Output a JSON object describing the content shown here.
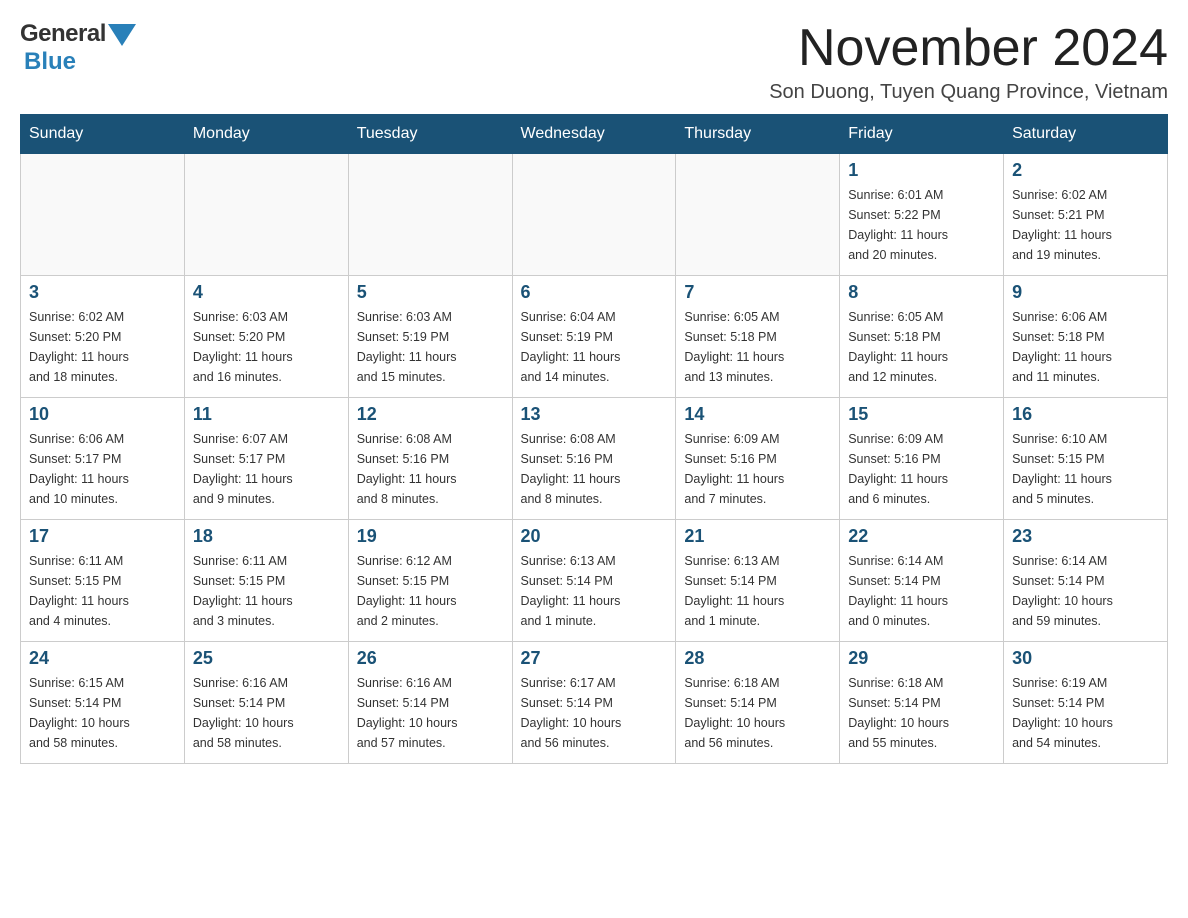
{
  "header": {
    "logo": {
      "general": "General",
      "blue": "Blue",
      "arrow_color": "#2980b9"
    },
    "title": "November 2024",
    "location": "Son Duong, Tuyen Quang Province, Vietnam"
  },
  "calendar": {
    "days_of_week": [
      "Sunday",
      "Monday",
      "Tuesday",
      "Wednesday",
      "Thursday",
      "Friday",
      "Saturday"
    ],
    "weeks": [
      {
        "days": [
          {
            "date": "",
            "info": ""
          },
          {
            "date": "",
            "info": ""
          },
          {
            "date": "",
            "info": ""
          },
          {
            "date": "",
            "info": ""
          },
          {
            "date": "",
            "info": ""
          },
          {
            "date": "1",
            "info": "Sunrise: 6:01 AM\nSunset: 5:22 PM\nDaylight: 11 hours\nand 20 minutes."
          },
          {
            "date": "2",
            "info": "Sunrise: 6:02 AM\nSunset: 5:21 PM\nDaylight: 11 hours\nand 19 minutes."
          }
        ]
      },
      {
        "days": [
          {
            "date": "3",
            "info": "Sunrise: 6:02 AM\nSunset: 5:20 PM\nDaylight: 11 hours\nand 18 minutes."
          },
          {
            "date": "4",
            "info": "Sunrise: 6:03 AM\nSunset: 5:20 PM\nDaylight: 11 hours\nand 16 minutes."
          },
          {
            "date": "5",
            "info": "Sunrise: 6:03 AM\nSunset: 5:19 PM\nDaylight: 11 hours\nand 15 minutes."
          },
          {
            "date": "6",
            "info": "Sunrise: 6:04 AM\nSunset: 5:19 PM\nDaylight: 11 hours\nand 14 minutes."
          },
          {
            "date": "7",
            "info": "Sunrise: 6:05 AM\nSunset: 5:18 PM\nDaylight: 11 hours\nand 13 minutes."
          },
          {
            "date": "8",
            "info": "Sunrise: 6:05 AM\nSunset: 5:18 PM\nDaylight: 11 hours\nand 12 minutes."
          },
          {
            "date": "9",
            "info": "Sunrise: 6:06 AM\nSunset: 5:18 PM\nDaylight: 11 hours\nand 11 minutes."
          }
        ]
      },
      {
        "days": [
          {
            "date": "10",
            "info": "Sunrise: 6:06 AM\nSunset: 5:17 PM\nDaylight: 11 hours\nand 10 minutes."
          },
          {
            "date": "11",
            "info": "Sunrise: 6:07 AM\nSunset: 5:17 PM\nDaylight: 11 hours\nand 9 minutes."
          },
          {
            "date": "12",
            "info": "Sunrise: 6:08 AM\nSunset: 5:16 PM\nDaylight: 11 hours\nand 8 minutes."
          },
          {
            "date": "13",
            "info": "Sunrise: 6:08 AM\nSunset: 5:16 PM\nDaylight: 11 hours\nand 8 minutes."
          },
          {
            "date": "14",
            "info": "Sunrise: 6:09 AM\nSunset: 5:16 PM\nDaylight: 11 hours\nand 7 minutes."
          },
          {
            "date": "15",
            "info": "Sunrise: 6:09 AM\nSunset: 5:16 PM\nDaylight: 11 hours\nand 6 minutes."
          },
          {
            "date": "16",
            "info": "Sunrise: 6:10 AM\nSunset: 5:15 PM\nDaylight: 11 hours\nand 5 minutes."
          }
        ]
      },
      {
        "days": [
          {
            "date": "17",
            "info": "Sunrise: 6:11 AM\nSunset: 5:15 PM\nDaylight: 11 hours\nand 4 minutes."
          },
          {
            "date": "18",
            "info": "Sunrise: 6:11 AM\nSunset: 5:15 PM\nDaylight: 11 hours\nand 3 minutes."
          },
          {
            "date": "19",
            "info": "Sunrise: 6:12 AM\nSunset: 5:15 PM\nDaylight: 11 hours\nand 2 minutes."
          },
          {
            "date": "20",
            "info": "Sunrise: 6:13 AM\nSunset: 5:14 PM\nDaylight: 11 hours\nand 1 minute."
          },
          {
            "date": "21",
            "info": "Sunrise: 6:13 AM\nSunset: 5:14 PM\nDaylight: 11 hours\nand 1 minute."
          },
          {
            "date": "22",
            "info": "Sunrise: 6:14 AM\nSunset: 5:14 PM\nDaylight: 11 hours\nand 0 minutes."
          },
          {
            "date": "23",
            "info": "Sunrise: 6:14 AM\nSunset: 5:14 PM\nDaylight: 10 hours\nand 59 minutes."
          }
        ]
      },
      {
        "days": [
          {
            "date": "24",
            "info": "Sunrise: 6:15 AM\nSunset: 5:14 PM\nDaylight: 10 hours\nand 58 minutes."
          },
          {
            "date": "25",
            "info": "Sunrise: 6:16 AM\nSunset: 5:14 PM\nDaylight: 10 hours\nand 58 minutes."
          },
          {
            "date": "26",
            "info": "Sunrise: 6:16 AM\nSunset: 5:14 PM\nDaylight: 10 hours\nand 57 minutes."
          },
          {
            "date": "27",
            "info": "Sunrise: 6:17 AM\nSunset: 5:14 PM\nDaylight: 10 hours\nand 56 minutes."
          },
          {
            "date": "28",
            "info": "Sunrise: 6:18 AM\nSunset: 5:14 PM\nDaylight: 10 hours\nand 56 minutes."
          },
          {
            "date": "29",
            "info": "Sunrise: 6:18 AM\nSunset: 5:14 PM\nDaylight: 10 hours\nand 55 minutes."
          },
          {
            "date": "30",
            "info": "Sunrise: 6:19 AM\nSunset: 5:14 PM\nDaylight: 10 hours\nand 54 minutes."
          }
        ]
      }
    ]
  }
}
